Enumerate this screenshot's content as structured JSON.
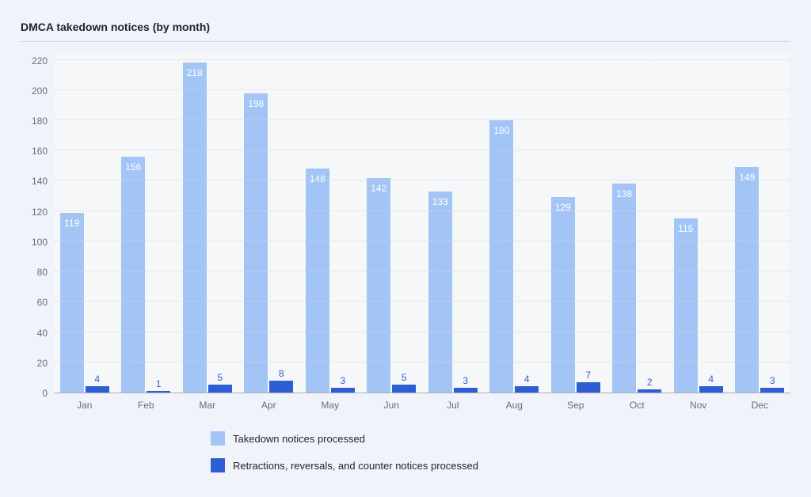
{
  "title": "DMCA takedown notices (by month)",
  "y_ticks": [
    0,
    20,
    40,
    60,
    80,
    100,
    120,
    140,
    160,
    180,
    200,
    220
  ],
  "y_max": 225,
  "legend": {
    "a": "Takedown notices processed",
    "b": "Retractions, reversals, and counter notices processed"
  },
  "months": [
    {
      "label": "Jan",
      "a": 119,
      "b": 4
    },
    {
      "label": "Feb",
      "a": 156,
      "b": 1
    },
    {
      "label": "Mar",
      "a": 218,
      "b": 5
    },
    {
      "label": "Apr",
      "a": 198,
      "b": 8
    },
    {
      "label": "May",
      "a": 148,
      "b": 3
    },
    {
      "label": "Jun",
      "a": 142,
      "b": 5
    },
    {
      "label": "Jul",
      "a": 133,
      "b": 3
    },
    {
      "label": "Aug",
      "a": 180,
      "b": 4
    },
    {
      "label": "Sep",
      "a": 129,
      "b": 7
    },
    {
      "label": "Oct",
      "a": 138,
      "b": 2
    },
    {
      "label": "Nov",
      "a": 115,
      "b": 4
    },
    {
      "label": "Dec",
      "a": 149,
      "b": 3
    }
  ],
  "chart_data": {
    "type": "bar",
    "title": "DMCA takedown notices (by month)",
    "xlabel": "",
    "ylabel": "",
    "ylim": [
      0,
      220
    ],
    "categories": [
      "Jan",
      "Feb",
      "Mar",
      "Apr",
      "May",
      "Jun",
      "Jul",
      "Aug",
      "Sep",
      "Oct",
      "Nov",
      "Dec"
    ],
    "series": [
      {
        "name": "Takedown notices processed",
        "values": [
          119,
          156,
          218,
          198,
          148,
          142,
          133,
          180,
          129,
          138,
          115,
          149
        ],
        "color": "#a2c5f6"
      },
      {
        "name": "Retractions, reversals, and counter notices processed",
        "values": [
          4,
          1,
          5,
          8,
          3,
          5,
          3,
          4,
          7,
          2,
          4,
          3
        ],
        "color": "#2d5ed6"
      }
    ],
    "legend_position": "bottom",
    "grid": true
  }
}
